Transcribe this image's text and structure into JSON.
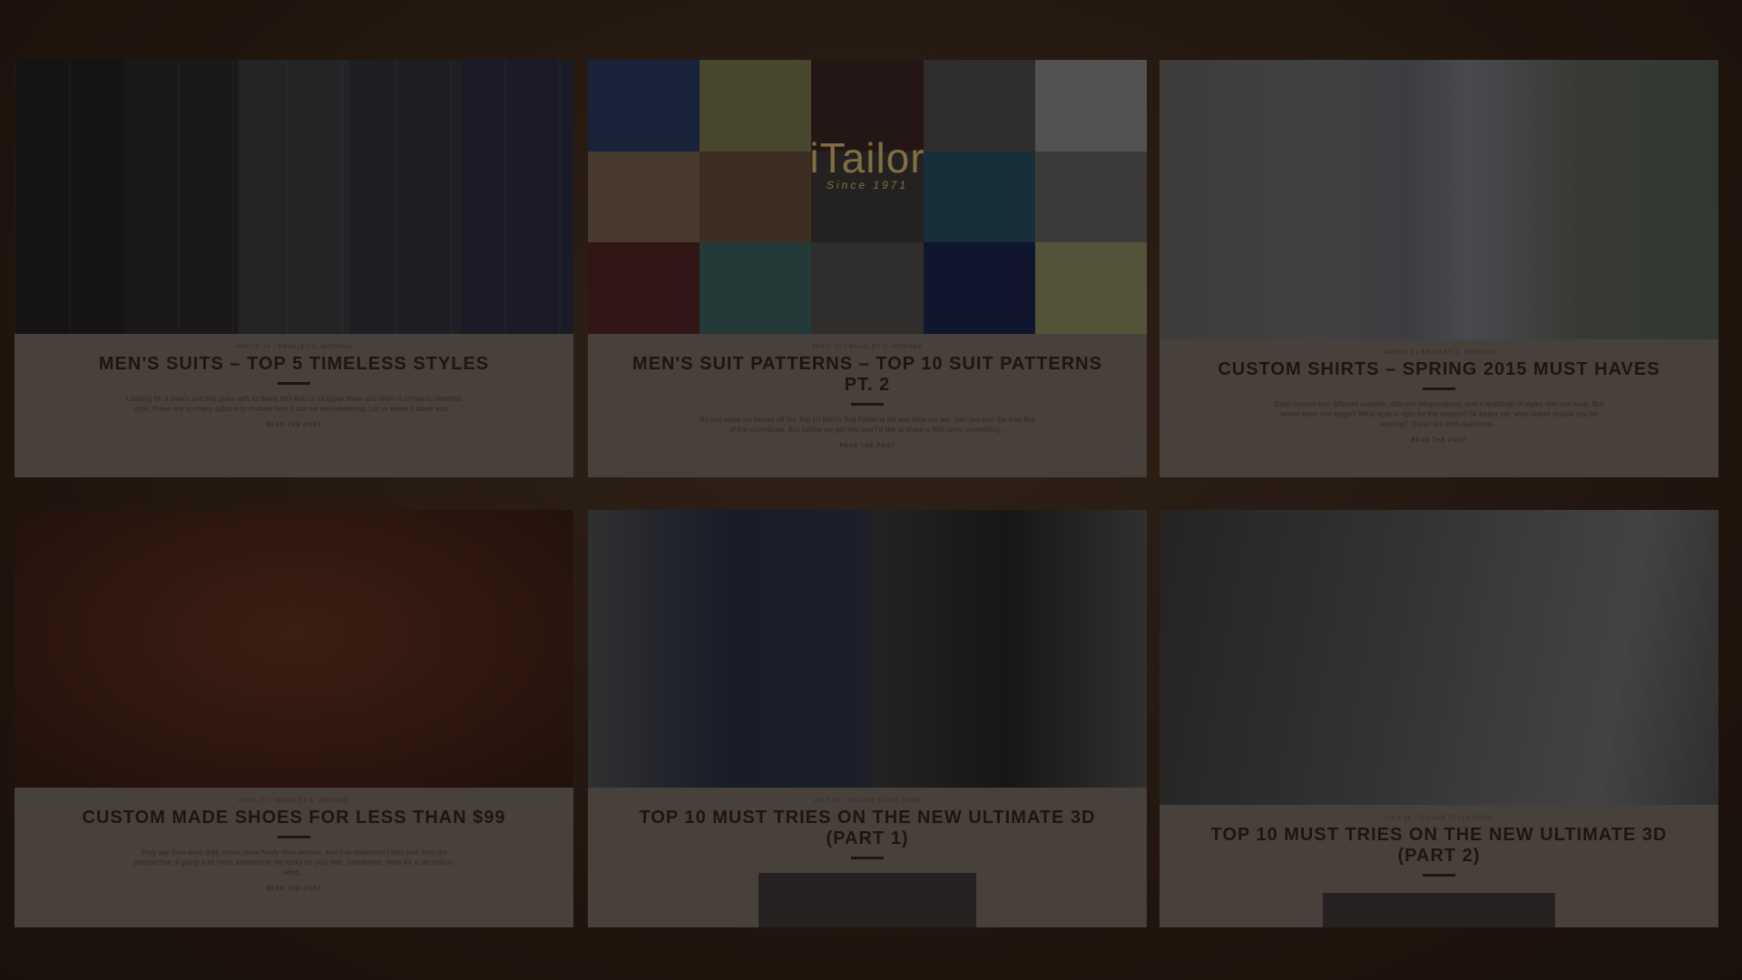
{
  "posts": [
    {
      "meta": "MARCH 24 / BRADLEY A. MORONG",
      "title": "MEN'S SUITS – TOP 5 TIMELESS STYLES",
      "excerpt": "Looking for a men's suit that goes with its finest tie? Ask us all types there and when it comes to timeless style, these are so many options to choose from it can be overwhelming. Let us break it down and...",
      "read_more": "READ THE POST"
    },
    {
      "meta": "APRIL 22 / BRADLEY A. MORONG",
      "title": "MEN'S SUIT PATTERNS – TOP 10 SUIT PATTERNS PT. 2",
      "excerpt": "So last week we kicked off the Top 10 Men's Suit Patterns list and here we are, part two and the final five of the countdown. But before we get into that I'd like to share a little story, something...",
      "read_more": "READ THE POST",
      "logo_name": "iTailor",
      "logo_since": "Since 1971"
    },
    {
      "meta": "MARCH 5 / BRADLEY A. MORONG",
      "title": "CUSTOM SHIRTS – SPRING 2015 MUST HAVES",
      "excerpt": "Each season has different weather, different temperatures, and a multitude of styles one can wear. But where does one begin? What style is right for the season? Or better yet, what colors should you be wearing? These are both questions...",
      "read_more": "READ THE POST"
    },
    {
      "meta": "APRIL 27 / BRADLEY A. MORONG",
      "title": "CUSTOM MADE SHOES FOR LESS THAN $99",
      "excerpt": "They say men wear their shoes more freely than women, and that statement holds true from the perspective of going a bit more attention to the looks on your feet. Gentlemen, think for a second on what...",
      "read_more": "READ THE POST"
    },
    {
      "meta": "JULY 16 / ITAILOR STYLE GURU",
      "title": "TOP 10 MUST TRIES ON THE NEW ULTIMATE 3D (PART 1)"
    },
    {
      "meta": "JULY 16 / ITAILOR STYLE GURU",
      "title": "TOP 10 MUST TRIES ON THE NEW ULTIMATE 3D (PART 2)"
    }
  ],
  "patterns": [
    "#1a2a4a",
    "#5a5a3a",
    "#2a1a1a",
    "#3a3a3a",
    "#6a6a6a",
    "#5a4a3a",
    "#4a3a2a",
    "#2a2a2a",
    "#1a3a4a",
    "#4a4a4a",
    "#3a1a1a",
    "#2a4a4a",
    "#3a3a3a",
    "#0e1a3a",
    "#6a6a4a"
  ]
}
